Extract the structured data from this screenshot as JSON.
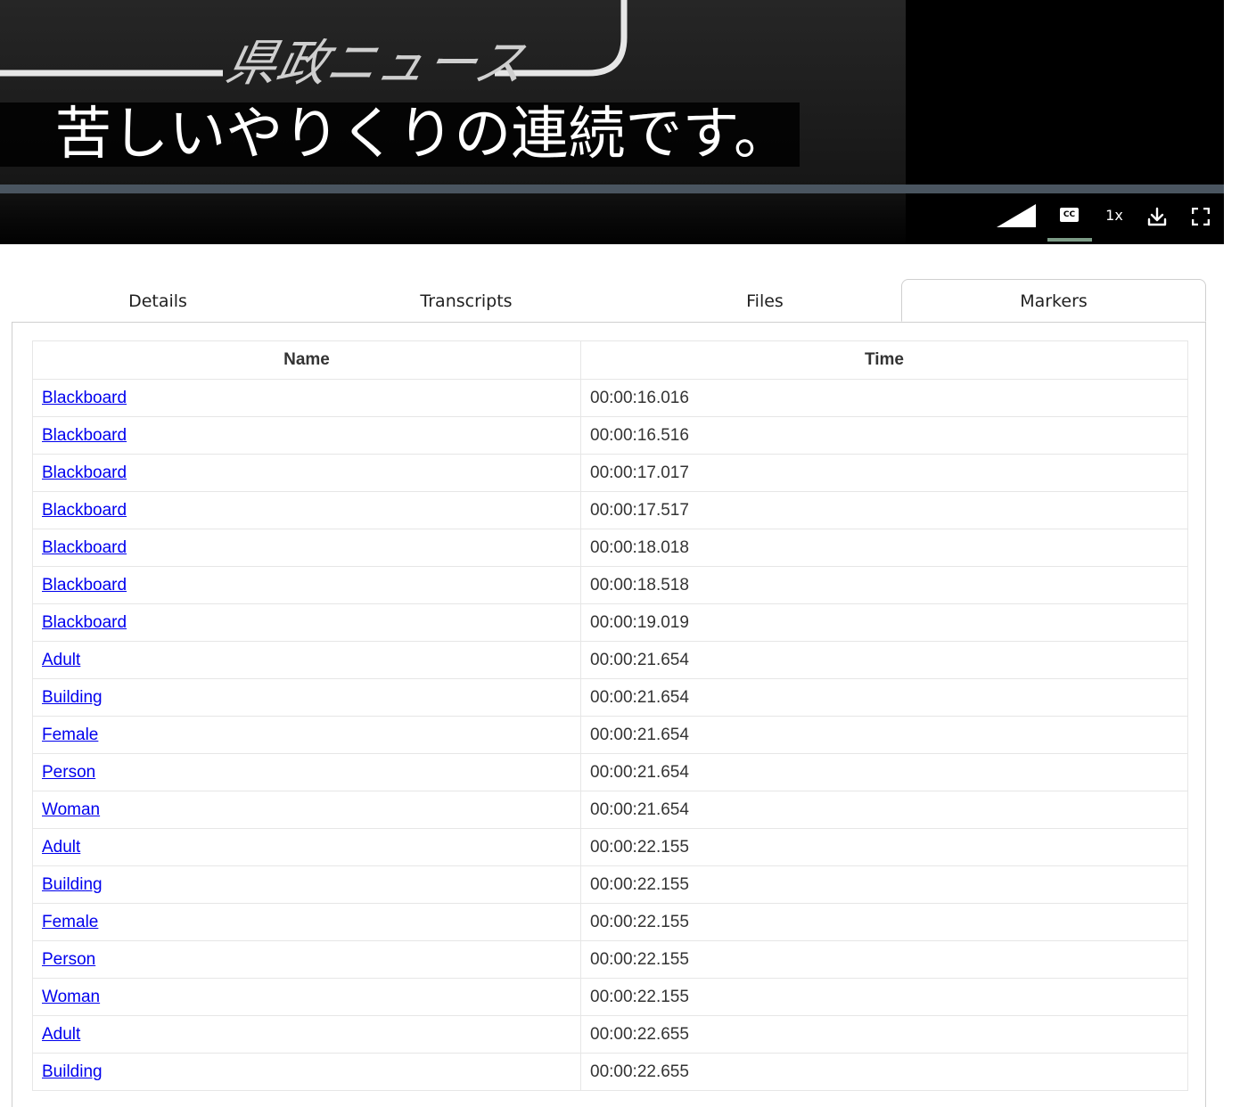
{
  "player": {
    "subtitle": "苦しいやりくりの連続です。",
    "video_overlay_text": "県政ニュース",
    "speed_label": "1x",
    "cc_label": "CC",
    "cc_active_color": "#7c9b86",
    "icons": {
      "volume": "volume-icon",
      "captions": "closed-captions-icon",
      "download": "download-icon",
      "fullscreen": "fullscreen-icon"
    }
  },
  "tabs": [
    {
      "label": "Details",
      "active": false
    },
    {
      "label": "Transcripts",
      "active": false
    },
    {
      "label": "Files",
      "active": false
    },
    {
      "label": "Markers",
      "active": true
    }
  ],
  "markers_table": {
    "headers": {
      "name": "Name",
      "time": "Time"
    },
    "rows": [
      {
        "name": "Blackboard",
        "time": "00:00:16.016"
      },
      {
        "name": "Blackboard",
        "time": "00:00:16.516"
      },
      {
        "name": "Blackboard",
        "time": "00:00:17.017"
      },
      {
        "name": "Blackboard",
        "time": "00:00:17.517"
      },
      {
        "name": "Blackboard",
        "time": "00:00:18.018"
      },
      {
        "name": "Blackboard",
        "time": "00:00:18.518"
      },
      {
        "name": "Blackboard",
        "time": "00:00:19.019"
      },
      {
        "name": "Adult",
        "time": "00:00:21.654"
      },
      {
        "name": "Building",
        "time": "00:00:21.654"
      },
      {
        "name": "Female",
        "time": "00:00:21.654"
      },
      {
        "name": "Person",
        "time": "00:00:21.654"
      },
      {
        "name": "Woman",
        "time": "00:00:21.654"
      },
      {
        "name": "Adult",
        "time": "00:00:22.155"
      },
      {
        "name": "Building",
        "time": "00:00:22.155"
      },
      {
        "name": "Female",
        "time": "00:00:22.155"
      },
      {
        "name": "Person",
        "time": "00:00:22.155"
      },
      {
        "name": "Woman",
        "time": "00:00:22.155"
      },
      {
        "name": "Adult",
        "time": "00:00:22.655"
      },
      {
        "name": "Building",
        "time": "00:00:22.655"
      }
    ]
  }
}
